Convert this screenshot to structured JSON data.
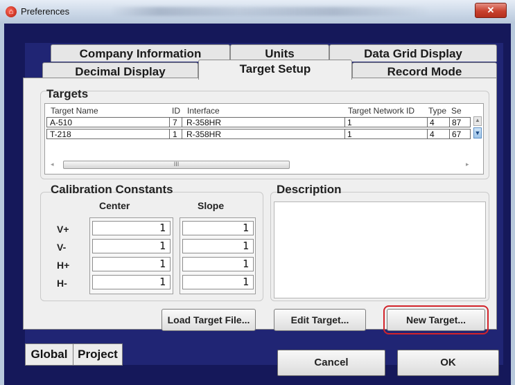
{
  "window": {
    "title": "Preferences",
    "close_symbol": "✕"
  },
  "tabs_row1": [
    {
      "label": "Company Information"
    },
    {
      "label": "Units"
    },
    {
      "label": "Data Grid Display"
    }
  ],
  "tabs_row2": [
    {
      "label": "Decimal Display"
    },
    {
      "label": "Target Setup",
      "active": true
    },
    {
      "label": "Record Mode"
    }
  ],
  "targets": {
    "label": "Targets",
    "columns": [
      "Target Name",
      "ID",
      "Interface",
      "Target Network ID",
      "Type",
      "Se"
    ],
    "rows": [
      {
        "name": "A-510",
        "id": "7",
        "interface": "R-358HR",
        "network_id": "1",
        "type": "4",
        "se": "87"
      },
      {
        "name": "T-218",
        "id": "1",
        "interface": "R-358HR",
        "network_id": "1",
        "type": "4",
        "se": "67"
      }
    ],
    "scroll_thumb_grip": "III"
  },
  "calibration": {
    "label": "Calibration Constants",
    "center_label": "Center",
    "slope_label": "Slope",
    "rows": [
      {
        "label": "V+",
        "center": "1",
        "slope": "1"
      },
      {
        "label": "V-",
        "center": "1",
        "slope": "1"
      },
      {
        "label": "H+",
        "center": "1",
        "slope": "1"
      },
      {
        "label": "H-",
        "center": "1",
        "slope": "1"
      }
    ]
  },
  "description": {
    "label": "Description",
    "value": ""
  },
  "buttons": {
    "load_target_file": "Load Target File...",
    "edit_target": "Edit Target...",
    "new_target": "New Target..."
  },
  "bottom_tabs": {
    "global": "Global",
    "project": "Project"
  },
  "footer": {
    "cancel": "Cancel",
    "ok": "OK"
  },
  "colors": {
    "frame_bg": "#15185a",
    "panel_bg": "#202574",
    "highlight": "#d2232a"
  }
}
